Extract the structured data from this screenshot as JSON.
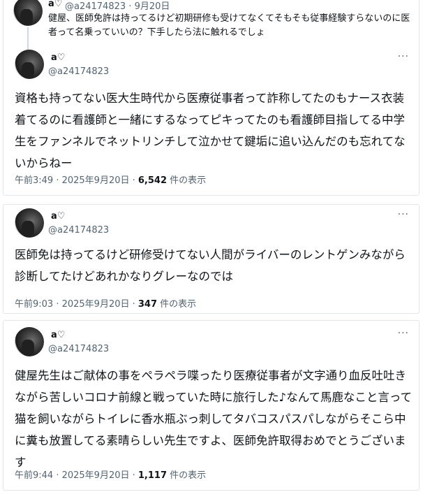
{
  "parent": {
    "name": "a♡",
    "handle": "@a24174823",
    "sep": "·",
    "date": "9月20日",
    "text": "健屋、医師免許は持ってるけど初期研修も受けてなくてそもそも従事経験すらないのに医者って名乗っていいの？下手したら法に触れるでしょ"
  },
  "posts": [
    {
      "name": "a♡",
      "handle": "@a24174823",
      "more": "···",
      "text": "資格も持ってない医大生時代から医療従事者って詐称してたのもナース衣装着てるのに看護師と一緒にするなってピキってたのも看護師目指してる中学生をファンネルでネットリンチして泣かせて鍵垢に追い込んだのも忘れてないからねー",
      "time": "午前3:49 · 2025年9月20日 · ",
      "views": "6,542",
      "views_label": " 件の表示"
    },
    {
      "name": "a♡",
      "handle": "@a24174823",
      "more": "···",
      "text": "医師免は持ってるけど研修受けてない人間がライバーのレントゲンみながら診断してたけどあれかなりグレーなのでは",
      "time": "午前9:03 · 2025年9月20日 · ",
      "views": "347",
      "views_label": " 件の表示"
    },
    {
      "name": "a♡",
      "handle": "@a24174823",
      "more": "···",
      "text": "健屋先生はご献体の事をペラペラ喋ったり医療従事者が文字通り血反吐吐きながら苦しいコロナ前線と戦っていた時に旅行した♪なんて馬鹿なこと言って猫を飼いながらトイレに香水瓶ぶっ刺してタバコスパスパしながらそこら中に糞も放置してる素晴らしい先生ですよ、医師免許取得おめでとうございます",
      "time": "午前9:44 · 2025年9月20日 · ",
      "views": "1,117",
      "views_label": " 件の表示"
    }
  ]
}
